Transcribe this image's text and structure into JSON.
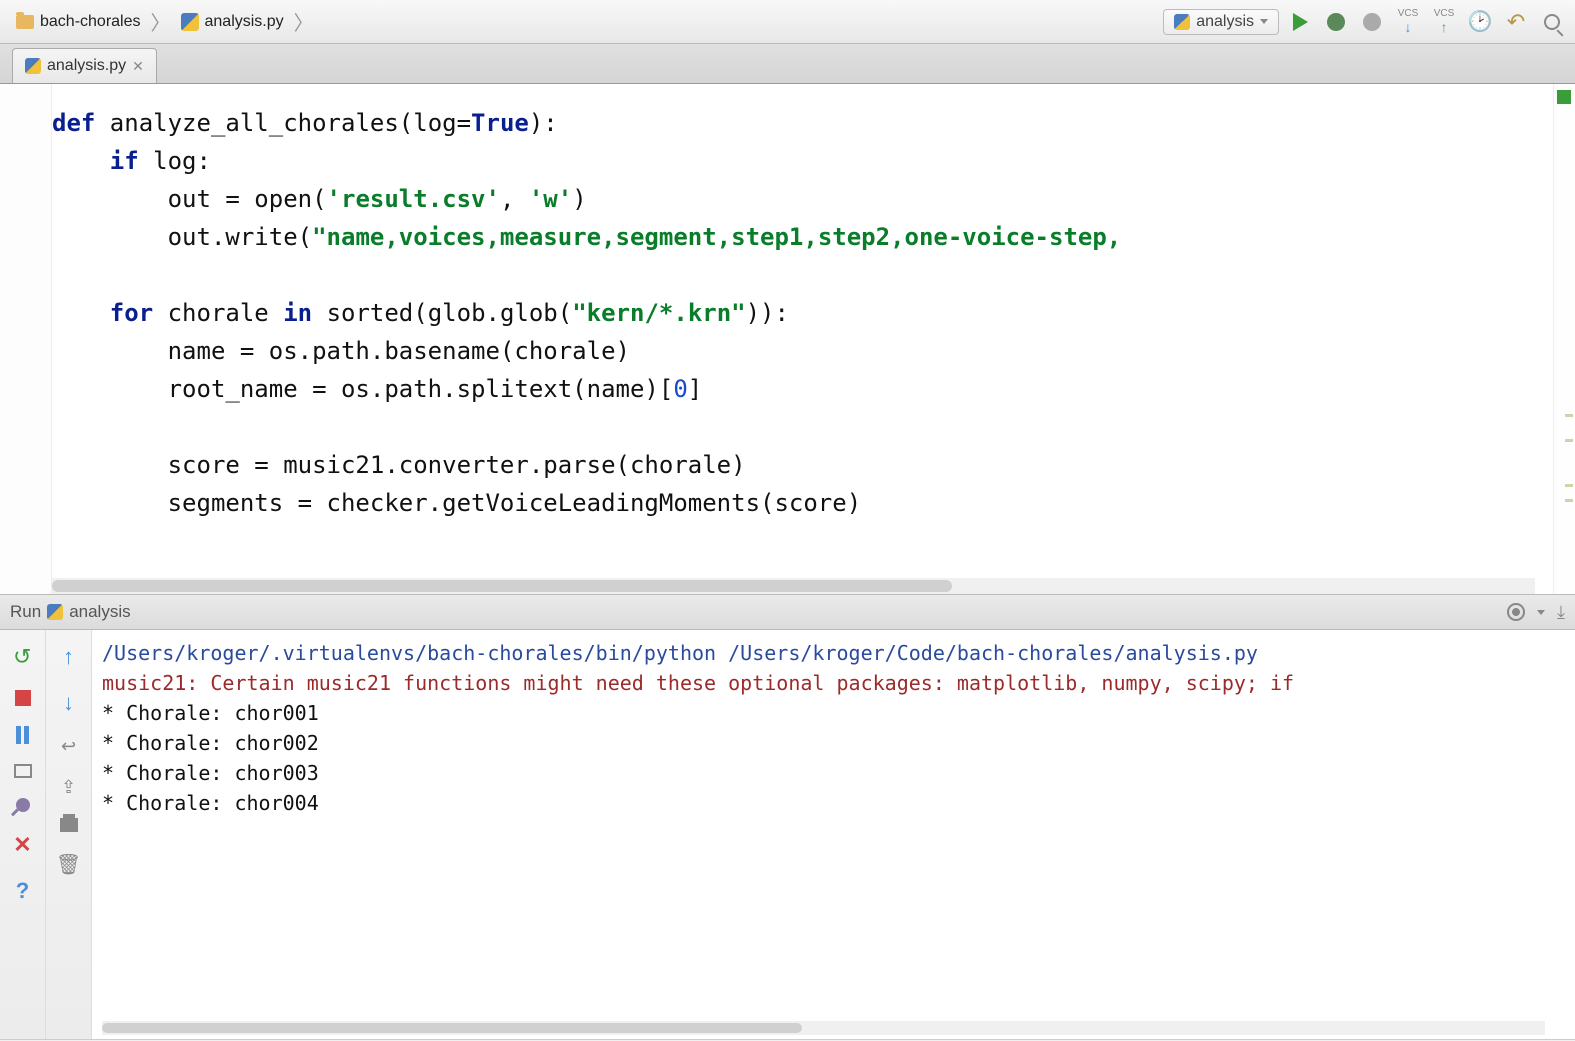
{
  "breadcrumb": {
    "project": "bach-chorales",
    "file": "analysis.py"
  },
  "run_config": {
    "selected": "analysis"
  },
  "tab": {
    "filename": "analysis.py"
  },
  "code": {
    "line1_def": "def",
    "line1_rest": " analyze_all_chorales(log=",
    "line1_true": "True",
    "line1_end": "):",
    "line2_if": "if",
    "line2_rest": " log:",
    "line3a": "        out = ",
    "line3_open": "open",
    "line3b": "(",
    "line3_s1": "'result.csv'",
    "line3c": ", ",
    "line3_s2": "'w'",
    "line3d": ")",
    "line4a": "        out.write(",
    "line4_s": "\"name,voices,measure,segment,step1,step2,one-voice-step,",
    "line6_for": "for",
    "line6a": " chorale ",
    "line6_in": "in",
    "line6b": " ",
    "line6_sorted": "sorted",
    "line6c": "(glob.glob(",
    "line6_s": "\"kern/*.krn\"",
    "line6d": ")):",
    "line7": "        name = os.path.basename(chorale)",
    "line8a": "        root_name = os.path.splitext(name)[",
    "line8_num": "0",
    "line8b": "]",
    "line10": "        score = music21.converter.parse(chorale)",
    "line11": "        segments = checker.getVoiceLeadingMoments(score)"
  },
  "run_panel": {
    "title": "Run",
    "name": "analysis"
  },
  "console": {
    "cmd": "/Users/kroger/.virtualenvs/bach-chorales/bin/python /Users/kroger/Code/bach-chorales/analysis.py",
    "warn": "music21: Certain music21 functions might need these optional packages: matplotlib, numpy, scipy; if",
    "l1": "* Chorale:  chor001",
    "l2": "* Chorale:  chor002",
    "l3": "* Chorale:  chor003",
    "l4": "* Chorale:  chor004"
  },
  "vcs": {
    "label": "VCS"
  }
}
